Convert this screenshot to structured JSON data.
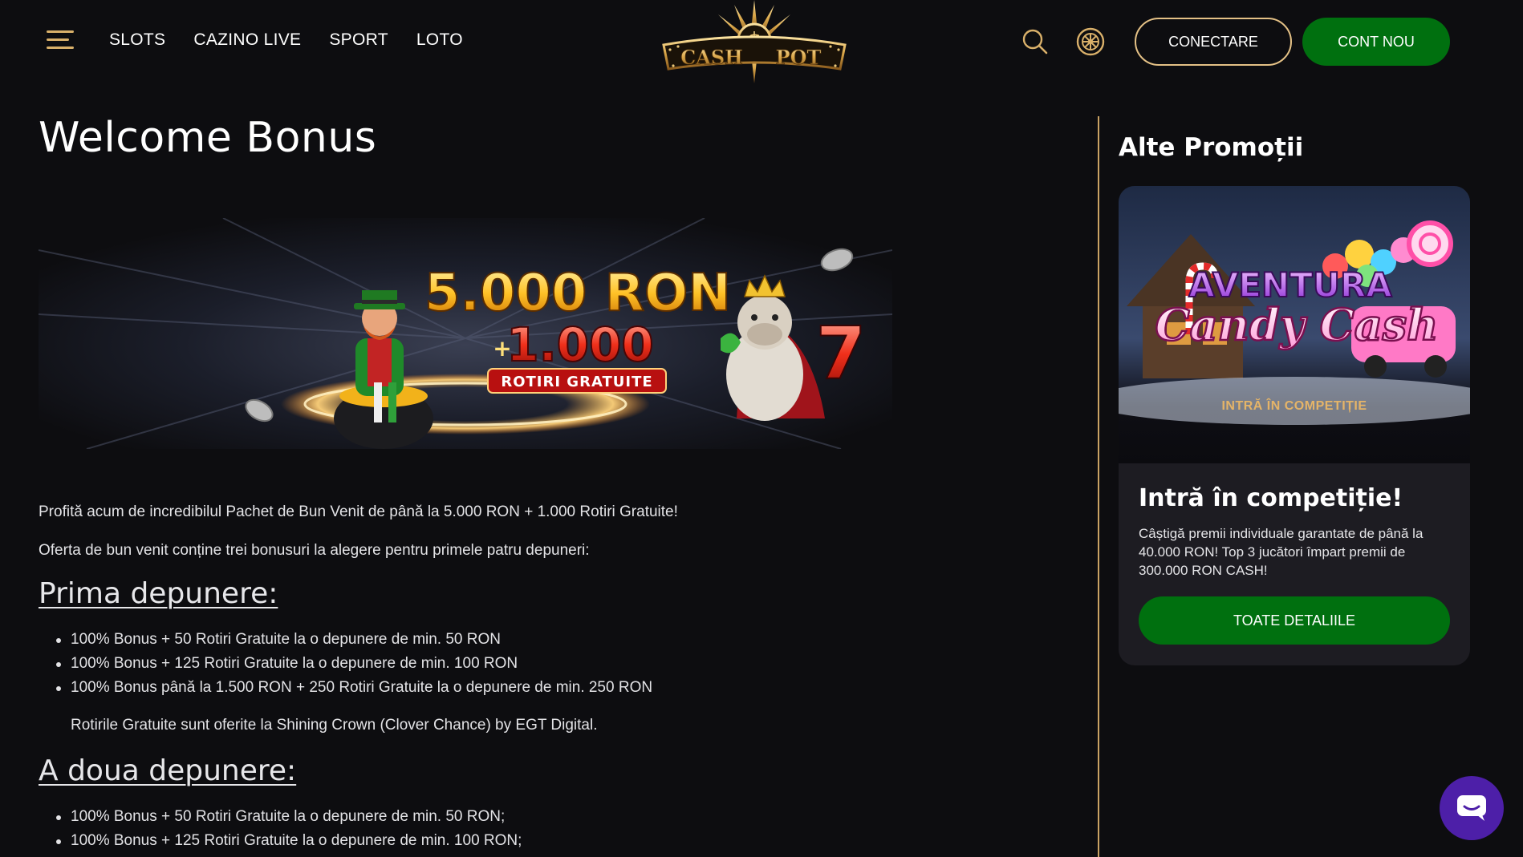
{
  "header": {
    "nav": [
      "SLOTS",
      "CAZINO LIVE",
      "SPORT",
      "LOTO"
    ],
    "logo_text": "CASH POT",
    "login_label": "CONECTARE",
    "register_label": "CONT NOU"
  },
  "main": {
    "title": "Welcome Bonus",
    "banner": {
      "amount": "5.000 RON",
      "plus_spins": "1.000",
      "spins_label": "ROTIRI GRATUITE"
    },
    "intro": [
      "Profită acum de incredibilul Pachet de Bun Venit de până la 5.000 RON + 1.000 Rotiri Gratuite!",
      "Oferta de bun venit conține trei bonusuri la alegere pentru primele patru depuneri:"
    ],
    "sections": [
      {
        "heading": "Prima depunere:",
        "items": [
          "100% Bonus + 50 Rotiri Gratuite la o depunere de min. 50 RON",
          "100% Bonus + 125 Rotiri Gratuite la o depunere de min. 100 RON",
          "100% Bonus până la 1.500 RON + 250 Rotiri Gratuite la o depunere de min. 250 RON"
        ],
        "note": "Rotirile Gratuite sunt oferite la Shining Crown (Clover Chance) by EGT Digital."
      },
      {
        "heading": "A doua depunere:",
        "items": [
          "100% Bonus + 50 Rotiri Gratuite la o depunere de min. 50 RON;",
          "100% Bonus + 125 Rotiri Gratuite la o depunere de min. 100 RON;"
        ]
      }
    ]
  },
  "sidebar": {
    "title": "Alte Promoții",
    "promo": {
      "image_title_line1": "AVENTURA",
      "image_title_line2": "Candy Cash",
      "image_cta": "INTRĂ ÎN COMPETIȚIE",
      "heading": "Intră în competiție!",
      "text": "Câștigă premii individuale garantate de până la 40.000 RON! Top 3 jucători împart premii de 300.000 RON CASH!",
      "button_label": "TOATE DETALIILE"
    }
  },
  "colors": {
    "background": "#0d0d10",
    "gold": "#d9b06a",
    "green": "#00700f",
    "card": "#1d1c22",
    "chat": "#4d1fa8"
  },
  "icons": [
    "menu-icon",
    "search-icon",
    "wheel-icon",
    "chat-icon"
  ]
}
